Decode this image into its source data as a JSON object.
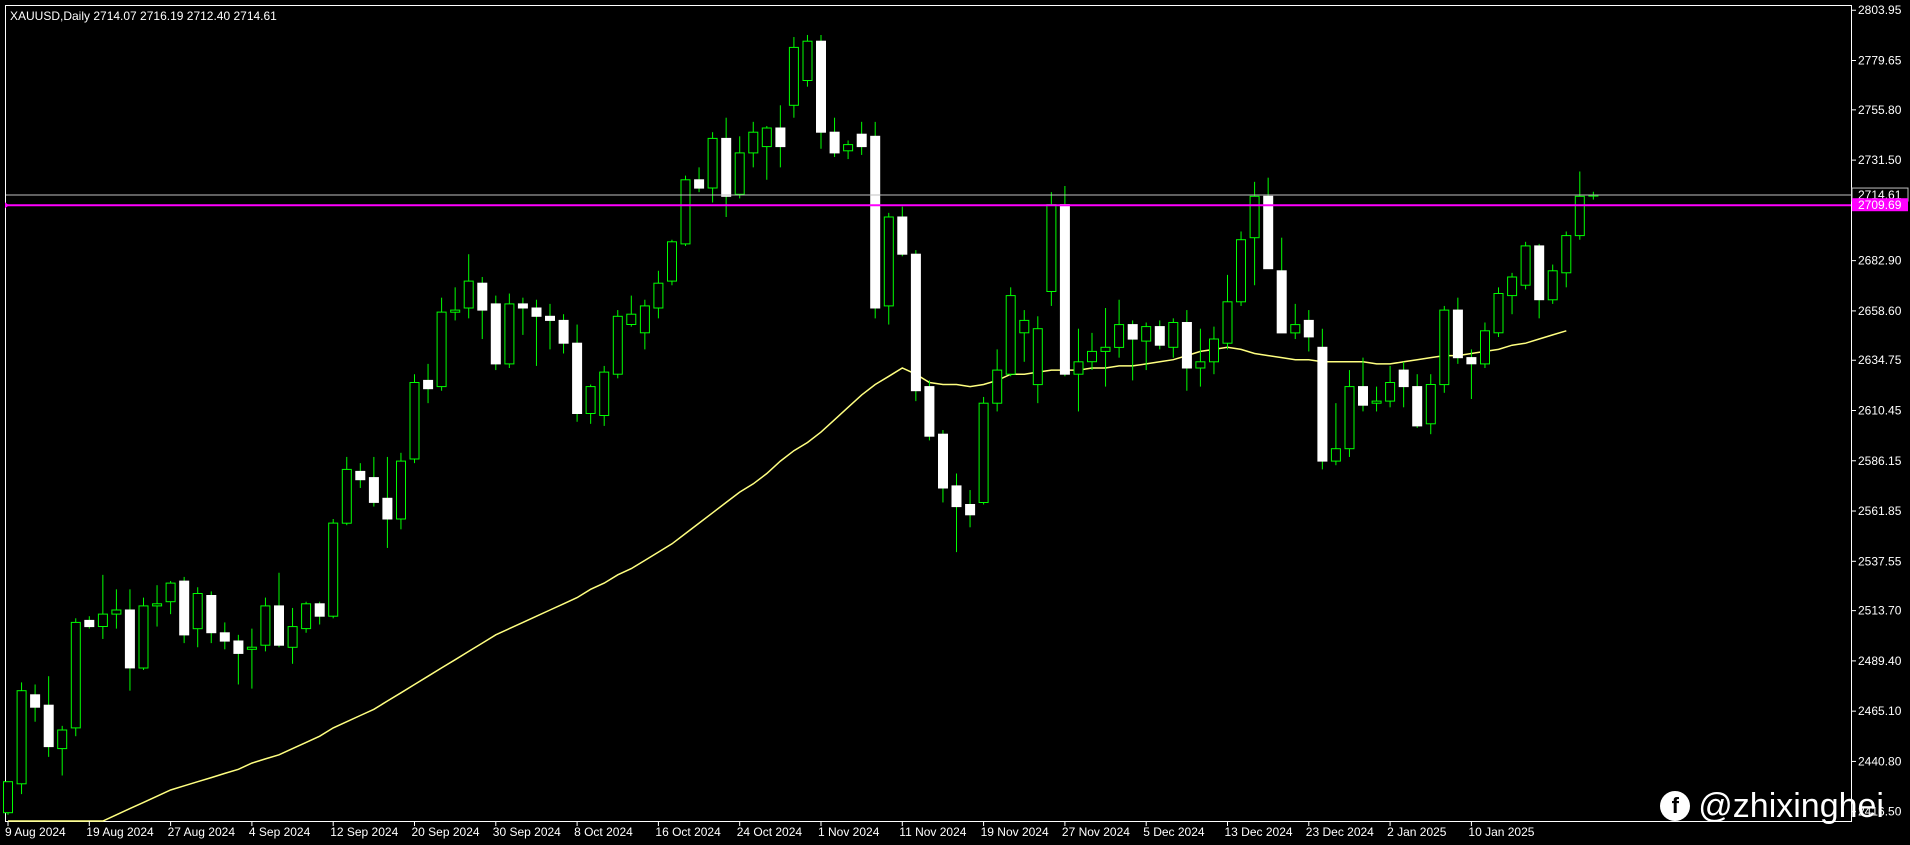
{
  "window": {
    "symbol_info": "XAUUSD,Daily  2714.07 2716.19 2712.40 2714.61"
  },
  "watermark": {
    "handle": "@zhixinghei",
    "icon": "facebook-icon",
    "icon_letter": "f"
  },
  "colors": {
    "background": "#000000",
    "frame": "#ffffff",
    "bull_candle": "#000000",
    "bull_outline": "#00ff00",
    "bear_candle": "#ffffff",
    "wick": "#00ff00",
    "moving_average": "#ffff80",
    "bid_line": "#c0c0c0",
    "alert_line": "#ff00ff",
    "axis_text": "#ffffff"
  },
  "chart_data": {
    "type": "candlestick",
    "symbol": "XAUUSD",
    "timeframe": "Daily",
    "ylim": [
      2412.0,
      2806.0
    ],
    "y_ticks": [
      2803.95,
      2779.65,
      2755.8,
      2731.5,
      2682.9,
      2658.6,
      2634.75,
      2610.45,
      2586.15,
      2561.85,
      2537.55,
      2513.7,
      2489.4,
      2465.1,
      2440.8,
      2416.5
    ],
    "y_tick_labels": [
      "2803.95",
      "2779.65",
      "2755.80",
      "2731.50",
      "2682.90",
      "2658.60",
      "2634.75",
      "2610.45",
      "2586.15",
      "2561.85",
      "2537.55",
      "2513.70",
      "2489.40",
      "2465.10",
      "2440.80",
      "2416.50"
    ],
    "x_tick_labels": [
      "9 Aug 2024",
      "19 Aug 2024",
      "27 Aug 2024",
      "4 Sep 2024",
      "12 Sep 2024",
      "20 Sep 2024",
      "30 Sep 2024",
      "8 Oct 2024",
      "16 Oct 2024",
      "24 Oct 2024",
      "1 Nov 2024",
      "11 Nov 2024",
      "19 Nov 2024",
      "27 Nov 2024",
      "5 Dec 2024",
      "13 Dec 2024",
      "23 Dec 2024",
      "2 Jan 2025",
      "10 Jan 2025"
    ],
    "x_tick_candle_index": [
      0,
      6,
      12,
      18,
      24,
      30,
      36,
      42,
      48,
      54,
      60,
      66,
      72,
      78,
      84,
      90,
      96,
      102,
      108
    ],
    "bid_price": 2714.61,
    "bid_label": "2714.61",
    "alert_price": 2709.69,
    "alert_label": "2709.69",
    "candles": [
      {
        "o": 2416,
        "h": 2431,
        "l": 2415,
        "c": 2431
      },
      {
        "o": 2430,
        "h": 2479,
        "l": 2425,
        "c": 2475
      },
      {
        "o": 2473,
        "h": 2478,
        "l": 2460,
        "c": 2467
      },
      {
        "o": 2468,
        "h": 2482,
        "l": 2443,
        "c": 2448
      },
      {
        "o": 2447,
        "h": 2458,
        "l": 2434,
        "c": 2456
      },
      {
        "o": 2457,
        "h": 2510,
        "l": 2453,
        "c": 2508
      },
      {
        "o": 2509,
        "h": 2511,
        "l": 2505,
        "c": 2506
      },
      {
        "o": 2506,
        "h": 2531,
        "l": 2500,
        "c": 2512
      },
      {
        "o": 2512,
        "h": 2524,
        "l": 2505,
        "c": 2514
      },
      {
        "o": 2514,
        "h": 2524,
        "l": 2475,
        "c": 2486
      },
      {
        "o": 2486,
        "h": 2520,
        "l": 2485,
        "c": 2516
      },
      {
        "o": 2516,
        "h": 2526,
        "l": 2506,
        "c": 2517
      },
      {
        "o": 2518,
        "h": 2528,
        "l": 2512,
        "c": 2527
      },
      {
        "o": 2528,
        "h": 2530,
        "l": 2498,
        "c": 2502
      },
      {
        "o": 2505,
        "h": 2525,
        "l": 2496,
        "c": 2522
      },
      {
        "o": 2521,
        "h": 2523,
        "l": 2498,
        "c": 2503
      },
      {
        "o": 2503,
        "h": 2508,
        "l": 2495,
        "c": 2499
      },
      {
        "o": 2499,
        "h": 2502,
        "l": 2478,
        "c": 2493
      },
      {
        "o": 2495,
        "h": 2505,
        "l": 2476,
        "c": 2496
      },
      {
        "o": 2497,
        "h": 2520,
        "l": 2494,
        "c": 2516
      },
      {
        "o": 2516,
        "h": 2532,
        "l": 2496,
        "c": 2497
      },
      {
        "o": 2496,
        "h": 2515,
        "l": 2488,
        "c": 2506
      },
      {
        "o": 2505,
        "h": 2518,
        "l": 2503,
        "c": 2517
      },
      {
        "o": 2517,
        "h": 2518,
        "l": 2507,
        "c": 2511
      },
      {
        "o": 2511,
        "h": 2558,
        "l": 2510,
        "c": 2556
      },
      {
        "o": 2556,
        "h": 2588,
        "l": 2555,
        "c": 2582
      },
      {
        "o": 2581,
        "h": 2585,
        "l": 2573,
        "c": 2577
      },
      {
        "o": 2578,
        "h": 2588,
        "l": 2564,
        "c": 2566
      },
      {
        "o": 2568,
        "h": 2588,
        "l": 2544,
        "c": 2558
      },
      {
        "o": 2558,
        "h": 2590,
        "l": 2553,
        "c": 2586
      },
      {
        "o": 2587,
        "h": 2628,
        "l": 2585,
        "c": 2624
      },
      {
        "o": 2625,
        "h": 2633,
        "l": 2614,
        "c": 2621
      },
      {
        "o": 2622,
        "h": 2665,
        "l": 2620,
        "c": 2658
      },
      {
        "o": 2658,
        "h": 2670,
        "l": 2654,
        "c": 2659
      },
      {
        "o": 2660,
        "h": 2686,
        "l": 2655,
        "c": 2673
      },
      {
        "o": 2672,
        "h": 2675,
        "l": 2645,
        "c": 2659
      },
      {
        "o": 2662,
        "h": 2666,
        "l": 2630,
        "c": 2633
      },
      {
        "o": 2633,
        "h": 2667,
        "l": 2631,
        "c": 2662
      },
      {
        "o": 2662,
        "h": 2665,
        "l": 2647,
        "c": 2660
      },
      {
        "o": 2660,
        "h": 2664,
        "l": 2632,
        "c": 2656
      },
      {
        "o": 2656,
        "h": 2662,
        "l": 2640,
        "c": 2654
      },
      {
        "o": 2654,
        "h": 2657,
        "l": 2638,
        "c": 2643
      },
      {
        "o": 2643,
        "h": 2652,
        "l": 2605,
        "c": 2609
      },
      {
        "o": 2609,
        "h": 2623,
        "l": 2604,
        "c": 2622
      },
      {
        "o": 2608,
        "h": 2632,
        "l": 2603,
        "c": 2629
      },
      {
        "o": 2628,
        "h": 2659,
        "l": 2626,
        "c": 2656
      },
      {
        "o": 2652,
        "h": 2666,
        "l": 2651,
        "c": 2657
      },
      {
        "o": 2648,
        "h": 2664,
        "l": 2640,
        "c": 2661
      },
      {
        "o": 2660,
        "h": 2678,
        "l": 2655,
        "c": 2672
      },
      {
        "o": 2673,
        "h": 2693,
        "l": 2671,
        "c": 2692
      },
      {
        "o": 2691,
        "h": 2724,
        "l": 2690,
        "c": 2722
      },
      {
        "o": 2722,
        "h": 2728,
        "l": 2716,
        "c": 2718
      },
      {
        "o": 2718,
        "h": 2745,
        "l": 2711,
        "c": 2742
      },
      {
        "o": 2742,
        "h": 2752,
        "l": 2704,
        "c": 2714
      },
      {
        "o": 2715,
        "h": 2743,
        "l": 2713,
        "c": 2735
      },
      {
        "o": 2735,
        "h": 2750,
        "l": 2728,
        "c": 2745
      },
      {
        "o": 2738,
        "h": 2748,
        "l": 2722,
        "c": 2747
      },
      {
        "o": 2747,
        "h": 2758,
        "l": 2728,
        "c": 2738
      },
      {
        "o": 2758,
        "h": 2791,
        "l": 2752,
        "c": 2786
      },
      {
        "o": 2770,
        "h": 2792,
        "l": 2767,
        "c": 2789
      },
      {
        "o": 2789,
        "h": 2792,
        "l": 2737,
        "c": 2745
      },
      {
        "o": 2745,
        "h": 2752,
        "l": 2733,
        "c": 2735
      },
      {
        "o": 2736,
        "h": 2741,
        "l": 2732,
        "c": 2739
      },
      {
        "o": 2744,
        "h": 2750,
        "l": 2734,
        "c": 2738
      },
      {
        "o": 2743,
        "h": 2750,
        "l": 2655,
        "c": 2660
      },
      {
        "o": 2661,
        "h": 2706,
        "l": 2652,
        "c": 2704
      },
      {
        "o": 2704,
        "h": 2709,
        "l": 2685,
        "c": 2686
      },
      {
        "o": 2686,
        "h": 2688,
        "l": 2615,
        "c": 2620
      },
      {
        "o": 2622,
        "h": 2625,
        "l": 2596,
        "c": 2598
      },
      {
        "o": 2599,
        "h": 2601,
        "l": 2566,
        "c": 2573
      },
      {
        "o": 2574,
        "h": 2580,
        "l": 2542,
        "c": 2564
      },
      {
        "o": 2565,
        "h": 2572,
        "l": 2554,
        "c": 2560
      },
      {
        "o": 2566,
        "h": 2617,
        "l": 2565,
        "c": 2614
      },
      {
        "o": 2614,
        "h": 2640,
        "l": 2610,
        "c": 2630
      },
      {
        "o": 2628,
        "h": 2670,
        "l": 2627,
        "c": 2666
      },
      {
        "o": 2648,
        "h": 2659,
        "l": 2634,
        "c": 2654
      },
      {
        "o": 2623,
        "h": 2656,
        "l": 2614,
        "c": 2650
      },
      {
        "o": 2668,
        "h": 2716,
        "l": 2661,
        "c": 2710
      },
      {
        "o": 2710,
        "h": 2719,
        "l": 2627,
        "c": 2628
      },
      {
        "o": 2628,
        "h": 2650,
        "l": 2610,
        "c": 2634
      },
      {
        "o": 2634,
        "h": 2648,
        "l": 2630,
        "c": 2639
      },
      {
        "o": 2639,
        "h": 2660,
        "l": 2622,
        "c": 2641
      },
      {
        "o": 2641,
        "h": 2664,
        "l": 2636,
        "c": 2652
      },
      {
        "o": 2652,
        "h": 2654,
        "l": 2625,
        "c": 2645
      },
      {
        "o": 2644,
        "h": 2653,
        "l": 2630,
        "c": 2651
      },
      {
        "o": 2651,
        "h": 2654,
        "l": 2640,
        "c": 2642
      },
      {
        "o": 2641,
        "h": 2655,
        "l": 2636,
        "c": 2653
      },
      {
        "o": 2653,
        "h": 2659,
        "l": 2620,
        "c": 2631
      },
      {
        "o": 2631,
        "h": 2650,
        "l": 2622,
        "c": 2634
      },
      {
        "o": 2634,
        "h": 2651,
        "l": 2628,
        "c": 2645
      },
      {
        "o": 2643,
        "h": 2676,
        "l": 2640,
        "c": 2663
      },
      {
        "o": 2663,
        "h": 2697,
        "l": 2661,
        "c": 2693
      },
      {
        "o": 2694,
        "h": 2721,
        "l": 2671,
        "c": 2714
      },
      {
        "o": 2714,
        "h": 2723,
        "l": 2700,
        "c": 2679
      },
      {
        "o": 2678,
        "h": 2694,
        "l": 2650,
        "c": 2648
      },
      {
        "o": 2648,
        "h": 2662,
        "l": 2645,
        "c": 2652
      },
      {
        "o": 2654,
        "h": 2659,
        "l": 2639,
        "c": 2646
      },
      {
        "o": 2641,
        "h": 2650,
        "l": 2582,
        "c": 2586
      },
      {
        "o": 2586,
        "h": 2614,
        "l": 2584,
        "c": 2592
      },
      {
        "o": 2592,
        "h": 2630,
        "l": 2588,
        "c": 2622
      },
      {
        "o": 2622,
        "h": 2636,
        "l": 2610,
        "c": 2613
      },
      {
        "o": 2614,
        "h": 2622,
        "l": 2610,
        "c": 2615
      },
      {
        "o": 2615,
        "h": 2632,
        "l": 2612,
        "c": 2624
      },
      {
        "o": 2630,
        "h": 2634,
        "l": 2612,
        "c": 2622
      },
      {
        "o": 2622,
        "h": 2628,
        "l": 2602,
        "c": 2603
      },
      {
        "o": 2604,
        "h": 2628,
        "l": 2599,
        "c": 2623
      },
      {
        "o": 2623,
        "h": 2661,
        "l": 2619,
        "c": 2659
      },
      {
        "o": 2659,
        "h": 2665,
        "l": 2633,
        "c": 2636
      },
      {
        "o": 2636,
        "h": 2640,
        "l": 2616,
        "c": 2633
      },
      {
        "o": 2633,
        "h": 2653,
        "l": 2631,
        "c": 2649
      },
      {
        "o": 2648,
        "h": 2670,
        "l": 2646,
        "c": 2667
      },
      {
        "o": 2666,
        "h": 2677,
        "l": 2657,
        "c": 2675
      },
      {
        "o": 2671,
        "h": 2692,
        "l": 2669,
        "c": 2690
      },
      {
        "o": 2690,
        "h": 2691,
        "l": 2655,
        "c": 2664
      },
      {
        "o": 2664,
        "h": 2681,
        "l": 2662,
        "c": 2678
      },
      {
        "o": 2677,
        "h": 2697,
        "l": 2670,
        "c": 2695
      },
      {
        "o": 2695,
        "h": 2726,
        "l": 2693,
        "c": 2714
      },
      {
        "o": 2714.07,
        "h": 2716.19,
        "l": 2712.4,
        "c": 2714.61
      }
    ],
    "ma": [
      2392,
      2395,
      2398,
      2401,
      2404,
      2407,
      2409,
      2412,
      2415,
      2418,
      2421,
      2424,
      2427,
      2429,
      2431,
      2433,
      2435,
      2437,
      2440,
      2442,
      2444,
      2447,
      2450,
      2453,
      2457,
      2460,
      2463,
      2466,
      2470,
      2474,
      2478,
      2482,
      2486,
      2490,
      2494,
      2498,
      2502,
      2505,
      2508,
      2511,
      2514,
      2517,
      2520,
      2524,
      2527,
      2531,
      2534,
      2538,
      2542,
      2546,
      2551,
      2556,
      2561,
      2566,
      2571,
      2575,
      2580,
      2586,
      2591,
      2595,
      2600,
      2606,
      2612,
      2618,
      2623,
      2627,
      2631,
      2628,
      2624,
      2623,
      2623,
      2622,
      2623,
      2625,
      2628,
      2628,
      2629,
      2630,
      2630,
      2630,
      2631,
      2631,
      2632,
      2632,
      2633,
      2634,
      2635,
      2637,
      2639,
      2640,
      2641,
      2640,
      2638,
      2637,
      2636,
      2635,
      2635,
      2634,
      2634,
      2634,
      2634,
      2633,
      2633,
      2634,
      2635,
      2636,
      2637,
      2637,
      2638,
      2639,
      2640,
      2642,
      2643,
      2645,
      2647,
      2649
    ]
  }
}
